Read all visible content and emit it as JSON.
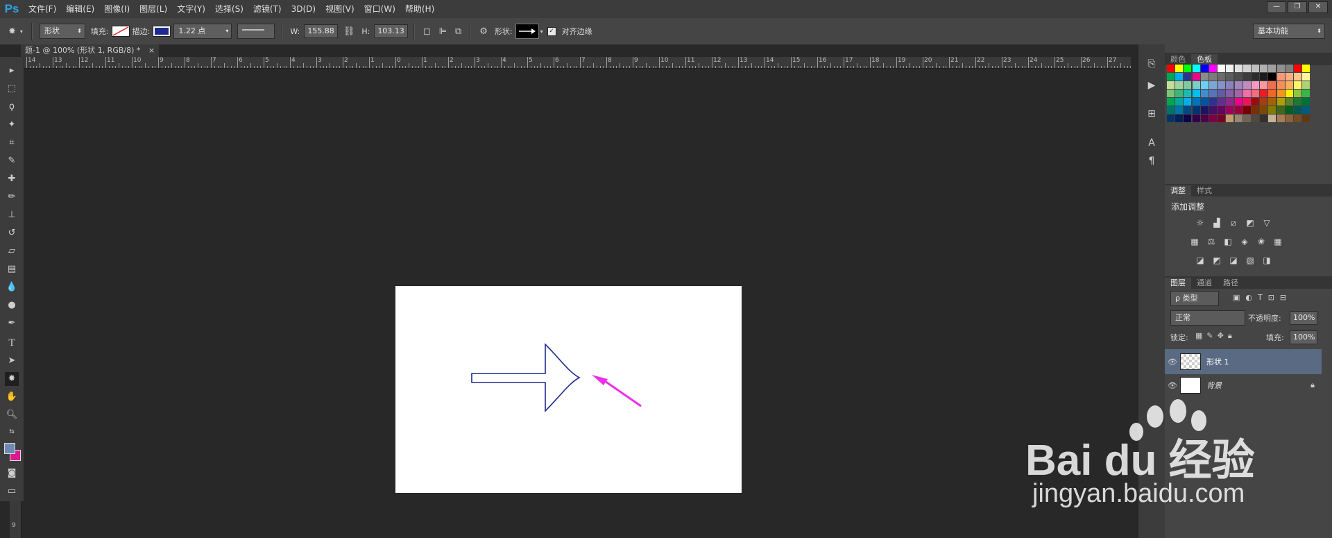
{
  "app": {
    "logo": "Ps",
    "menu": [
      "文件(F)",
      "编辑(E)",
      "图像(I)",
      "图层(L)",
      "文字(Y)",
      "选择(S)",
      "滤镜(T)",
      "3D(D)",
      "视图(V)",
      "窗口(W)",
      "帮助(H)"
    ],
    "window_controls": [
      "—",
      "❐",
      "✕"
    ]
  },
  "options": {
    "mode": "形状",
    "fill_label": "填充:",
    "stroke_label": "描边:",
    "stroke_width": "1.22 点",
    "w_label": "W:",
    "w_value": "155.88",
    "h_label": "H:",
    "h_value": "103.13",
    "shape_label": "形状:",
    "align_edges": "对齐边缘",
    "workspace": "基本功能",
    "stroke_color": "#1f2a8f"
  },
  "document": {
    "tab": "题-1 @ 100% (形状 1, RGB/8) *",
    "close": "×",
    "ruler_h": [
      "14",
      "13",
      "12",
      "11",
      "10",
      "9",
      "8",
      "7",
      "6",
      "5",
      "4",
      "3",
      "2",
      "1",
      "0",
      "1",
      "2",
      "3",
      "4",
      "5",
      "6",
      "7",
      "8",
      "9",
      "10",
      "11",
      "12",
      "13",
      "14",
      "15",
      "16",
      "17",
      "18",
      "19",
      "20",
      "21",
      "22",
      "23",
      "24",
      "25",
      "26",
      "27"
    ],
    "ruler_v_bottom": "9"
  },
  "panels": {
    "color_tabs": [
      "颜色",
      "色板"
    ],
    "adjust_tabs": [
      "调整",
      "样式"
    ],
    "adjust_title": "添加调整",
    "layer_tabs": [
      "图层",
      "通道",
      "路径"
    ],
    "filter_kind": "ρ 类型",
    "blend_mode": "正常",
    "opacity_label": "不透明度:",
    "opacity_value": "100%",
    "lock_label": "锁定:",
    "fill_label": "填充:",
    "fill_value": "100%",
    "layers": [
      {
        "name": "形状 1",
        "selected": true
      },
      {
        "name": "背景",
        "selected": false,
        "locked": true
      }
    ]
  },
  "watermark": {
    "brand": "Bai du 经验",
    "url": "jingyan.baidu.com"
  },
  "colors": {
    "arrow_stroke": "#1f2a8f",
    "annotation_arrow": "#ee2ee8",
    "selected_layer": "#5a6a82"
  }
}
